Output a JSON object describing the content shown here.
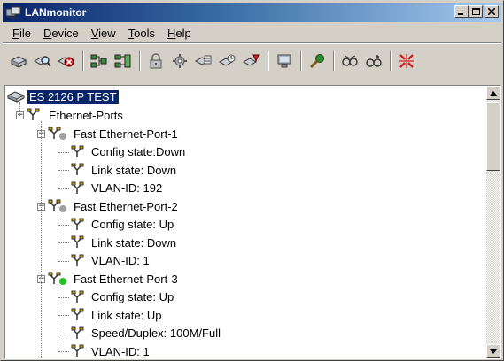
{
  "window": {
    "title": "LANmonitor",
    "app_icon": "lan-network-icon",
    "controls": {
      "minimize": "_",
      "maximize": "□",
      "close": "×"
    }
  },
  "menu": [
    {
      "label": "File",
      "accel": "F",
      "rest": "ile"
    },
    {
      "label": "Device",
      "accel": "D",
      "rest": "evice"
    },
    {
      "label": "View",
      "accel": "V",
      "rest": "iew"
    },
    {
      "label": "Tools",
      "accel": "T",
      "rest": "ools"
    },
    {
      "label": "Help",
      "accel": "H",
      "rest": "elp"
    }
  ],
  "toolbar": {
    "icons": [
      "add-device-icon",
      "search-device-icon",
      "delete-device-icon",
      "network-view-icon",
      "network-view-alt-icon",
      "lock-icon",
      "settings-gear-icon",
      "device-config-icon",
      "device-monitor-icon",
      "device-event-icon",
      "firewall-icon",
      "key-icon",
      "network-group-icon",
      "network-group-alt-icon",
      "expand-collapse-icon"
    ]
  },
  "tree": {
    "root": {
      "label": "ES 2126 P TEST",
      "selected": true
    },
    "group": {
      "label": "Ethernet-Ports"
    },
    "ports": [
      {
        "label": "Fast Ethernet-Port-1",
        "status_color": "#a0a0a0",
        "items": [
          "Config state:Down",
          "Link state: Down",
          "VLAN-ID: 192"
        ]
      },
      {
        "label": "Fast Ethernet-Port-2",
        "status_color": "#a0a0a0",
        "items": [
          "Config state: Up",
          "Link state: Down",
          "VLAN-ID: 1"
        ]
      },
      {
        "label": "Fast Ethernet-Port-3",
        "status_color": "#1fc51f",
        "items": [
          "Config state: Up",
          "Link state: Up",
          "Speed/Duplex: 100M/Full",
          "VLAN-ID: 1"
        ]
      }
    ]
  },
  "colors": {
    "titlebar_start": "#0a246a",
    "titlebar_end": "#a6caf0",
    "selection": "#0a246a",
    "port_icon": "#c8a000"
  }
}
